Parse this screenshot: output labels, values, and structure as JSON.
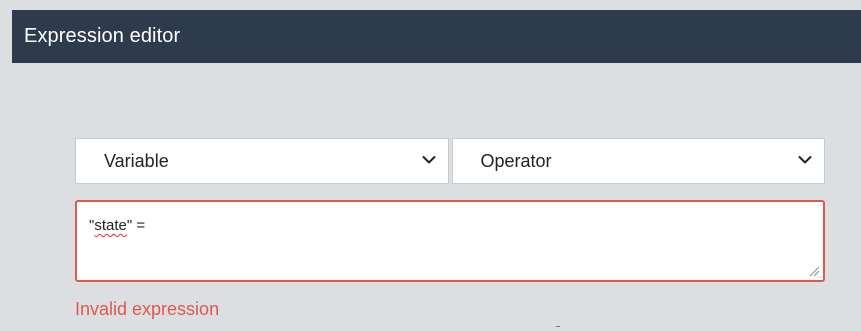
{
  "header": {
    "title": "Expression editor"
  },
  "selects": {
    "variable": {
      "value": "Variable",
      "icon": "chevron-down-icon"
    },
    "operator": {
      "value": "Operator",
      "icon": "chevron-down-icon"
    }
  },
  "expression": {
    "quote_open": "\"",
    "token": "state",
    "rest": "\" ="
  },
  "error": {
    "message": "Invalid expression"
  },
  "colors": {
    "header_bg": "#2e3b4c",
    "page_bg": "#dcdfe2",
    "error": "#e2574c"
  }
}
